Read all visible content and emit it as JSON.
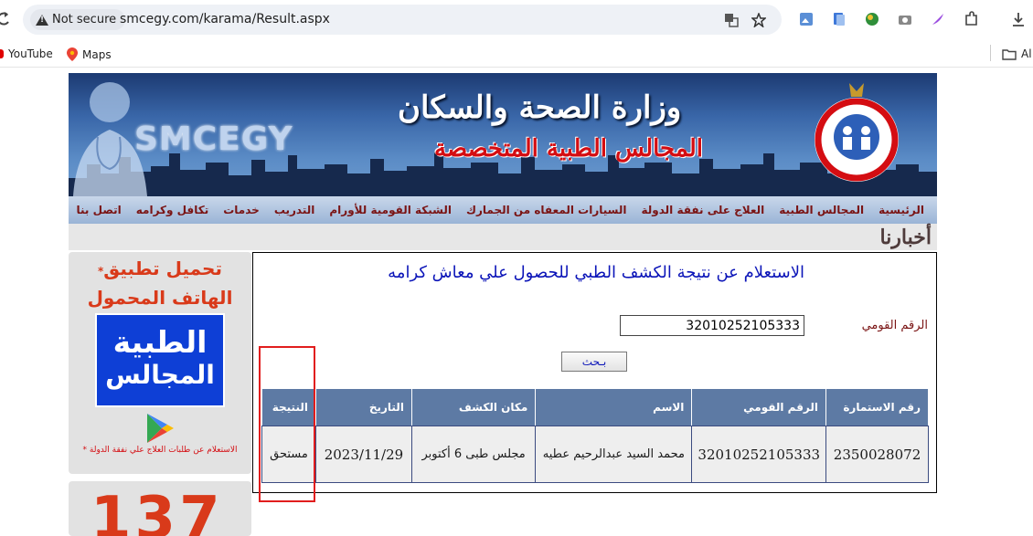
{
  "browser": {
    "security_label": "Not secure",
    "url": "smcegy.com/karama/Result.aspx",
    "bookmarks": [
      "YouTube",
      "Maps"
    ],
    "bookmark_folder": "Al"
  },
  "header": {
    "ministry_title": "وزارة الصحة والسكان",
    "council_title": "المجالس الطبية المتخصصة",
    "logo_text": "SMCEGY"
  },
  "nav": {
    "items": [
      "الرئيسية",
      "المجالس الطبية",
      "العلاج على نفقة الدولة",
      "السيارات المعفاه من الجمارك",
      "الشبكة القومية للأورام",
      "التدريب",
      "خدمات",
      "تكافل وكرامه",
      "اتصل بنا"
    ]
  },
  "news": {
    "title": "أخبارنا"
  },
  "sidebar": {
    "app_title_1": "تحميل تطبيق",
    "app_title_2": "الهاتف المحمول",
    "app_logo_1": "الطبية",
    "app_logo_2": "المجالس",
    "note": "الاستعلام عن طلبات العلاج علي نفقة الدولة",
    "counter": "137"
  },
  "query": {
    "title": "الاستعلام عن نتيجة الكشف الطبي للحصول علي معاش كرامه",
    "national_id_label": "الرقم القومي",
    "national_id_value": "32010252105333",
    "search_label": "بـحث"
  },
  "results": {
    "headers": [
      "رقم الاستمارة",
      "الرقم القومي",
      "الاسم",
      "مكان الكشف",
      "التاريخ",
      "النتيجة"
    ],
    "row": {
      "form_no": "2350028072",
      "national_id": "32010252105333",
      "name": "محمد السيد عبدالرحيم عطيه",
      "location": "مجلس طبى 6 أكتوبر",
      "date": "2023/11/29",
      "result": "مستحق"
    }
  },
  "colors": {
    "nav_text": "#7a1414",
    "header_bg": "#5d7aa4",
    "title_blue": "#0b14b8",
    "highlight": "#e11d1d"
  }
}
